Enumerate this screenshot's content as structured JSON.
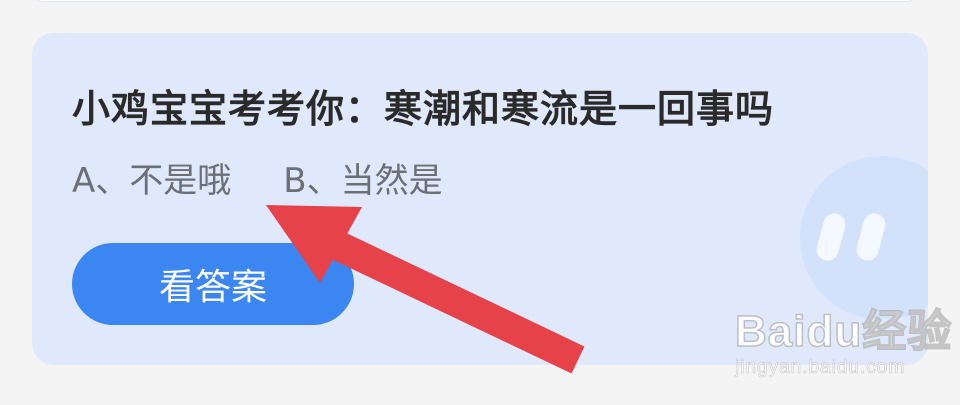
{
  "quiz": {
    "question": "小鸡宝宝考考你：寒潮和寒流是一回事吗",
    "options": [
      "A、不是哦",
      "B、当然是"
    ],
    "answer_button_label": "看答案"
  },
  "watermark": {
    "logo": "Baidu经验",
    "url": "jingyan.baidu.com"
  },
  "colors": {
    "page_background": "#f4f4f5",
    "card_background": "#dfe9fb",
    "button": "#3b86f0",
    "arrow": "#e6424a",
    "mascot": "#cfe0fa"
  }
}
